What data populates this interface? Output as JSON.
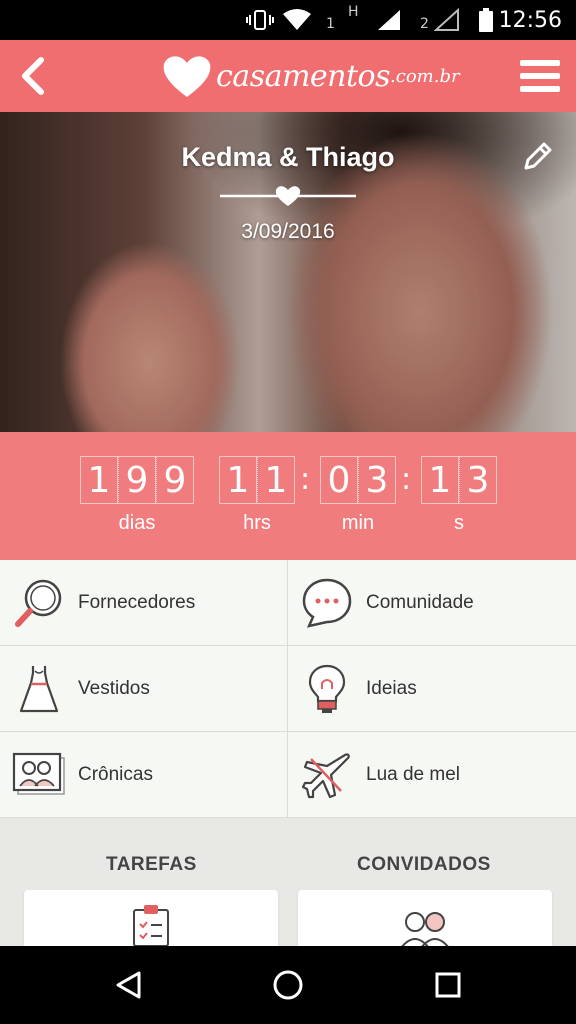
{
  "status_bar": {
    "sim1": "1",
    "network": "H",
    "sim2": "2",
    "time": "12:56",
    "icons": [
      "vibrate-icon",
      "wifi-icon",
      "signal-icon",
      "battery-icon"
    ]
  },
  "app_bar": {
    "logo_text": "casamentos",
    "logo_suffix": ".com.br",
    "back_icon": "chevron-left-icon",
    "menu_icon": "hamburger-menu-icon"
  },
  "hero": {
    "couple_name": "Kedma & Thiago",
    "date": "3/09/2016",
    "edit_icon": "pencil-icon"
  },
  "countdown": {
    "days": [
      "1",
      "9",
      "9"
    ],
    "hours": [
      "1",
      "1"
    ],
    "minutes": [
      "0",
      "3"
    ],
    "seconds": [
      "1",
      "3"
    ],
    "labels": {
      "days": "dias",
      "hours": "hrs",
      "minutes": "min",
      "seconds": "s"
    }
  },
  "menu": {
    "items": [
      {
        "label": "Fornecedores",
        "icon": "magnifier-icon"
      },
      {
        "label": "Comunidade",
        "icon": "chat-bubble-icon"
      },
      {
        "label": "Vestidos",
        "icon": "dress-icon"
      },
      {
        "label": "Ideias",
        "icon": "lightbulb-icon"
      },
      {
        "label": "Crônicas",
        "icon": "photo-frame-icon"
      },
      {
        "label": "Lua de mel",
        "icon": "airplane-icon"
      }
    ]
  },
  "sections": {
    "tasks_title": "TAREFAS",
    "guests_title": "CONVIDADOS"
  },
  "colors": {
    "primary": "#f06e70",
    "countdown_bg": "#f07c7e",
    "accent_icon": "#e0605f"
  }
}
